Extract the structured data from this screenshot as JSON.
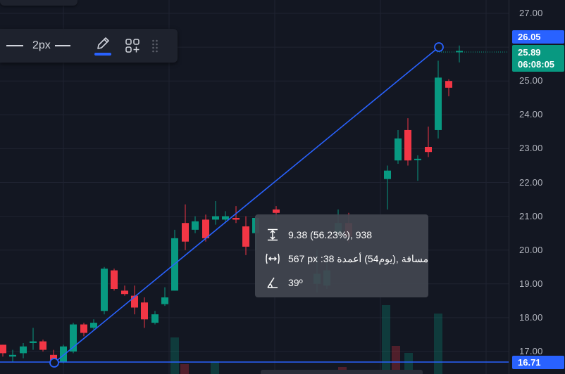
{
  "toolbar": {
    "line_width_label": "2px"
  },
  "price_scale": {
    "ticks": [
      "27.00",
      "25.00",
      "24.00",
      "23.00",
      "22.00",
      "21.00",
      "20.00",
      "19.00",
      "18.00",
      "17.00"
    ],
    "high_tag": "26.05",
    "last_price": "25.89",
    "countdown": "06:08:05",
    "low_tag": "16.71"
  },
  "measure": {
    "price_change": "9.38 (56.23%), 938",
    "bars_distance": "567 px :مسافة ,(يوم54) أعمدة 38",
    "angle": "39º"
  },
  "colors": {
    "background": "#131722",
    "up_candle": "#089981",
    "down_candle": "#f23645",
    "accent": "#2962ff"
  },
  "icons": {
    "pencil": "pencil-icon",
    "add_object": "grid-plus-icon",
    "drag": "drag-handle-icon",
    "price_range": "price-range-icon",
    "bar_range": "bar-range-icon",
    "angle": "angle-icon"
  }
}
